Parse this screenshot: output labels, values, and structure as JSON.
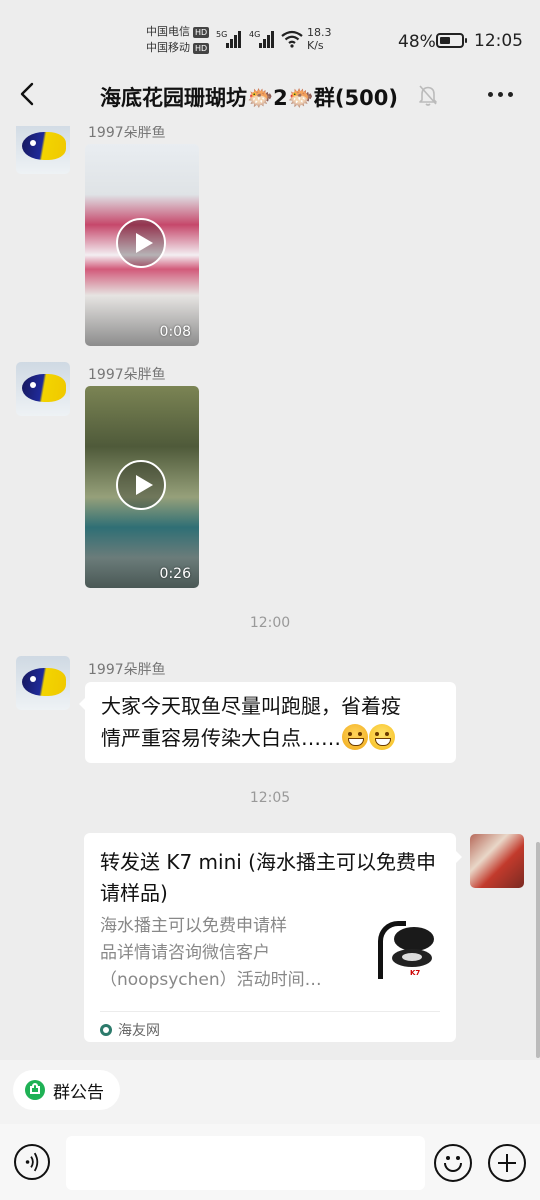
{
  "status_bar": {
    "carrier1": "中国电信",
    "carrier2": "中国移动",
    "hd": "HD",
    "sig1_label": "5G",
    "sig2_label": "4G",
    "speed_value": "18.3",
    "speed_unit": "K/s",
    "battery_percent": "48%",
    "battery_level": 0.48,
    "time": "12:05"
  },
  "header": {
    "title": "海底花园珊瑚坊🐡2🐡群(500)",
    "back_icon": "chevron-left-icon",
    "mute_icon": "bell-off-icon",
    "more_icon": "more-horizontal-icon"
  },
  "messages": [
    {
      "type": "video",
      "sender": "1997朵胖鱼",
      "duration": "0:08"
    },
    {
      "type": "video",
      "sender": "1997朵胖鱼",
      "duration": "0:26"
    },
    {
      "type": "timestamp",
      "text": "12:00"
    },
    {
      "type": "text",
      "sender": "1997朵胖鱼",
      "text_line1": "大家今天取鱼尽量叫跑腿，省着疫",
      "text_line2": "情严重容易传染大白点……"
    },
    {
      "type": "timestamp",
      "text": "12:05"
    },
    {
      "type": "link",
      "sender": "me",
      "title": "转发送 K7 mini (海水播主可以免费申请样品)",
      "desc_line1": "海水播主可以免费申请样",
      "desc_line2": "品详情请咨询微信客户",
      "desc_line3": "（noopsychen）活动时间…",
      "source": "海友网",
      "thumb_label": "K7"
    }
  ],
  "bottom": {
    "notice_label": "群公告",
    "input_value": ""
  }
}
